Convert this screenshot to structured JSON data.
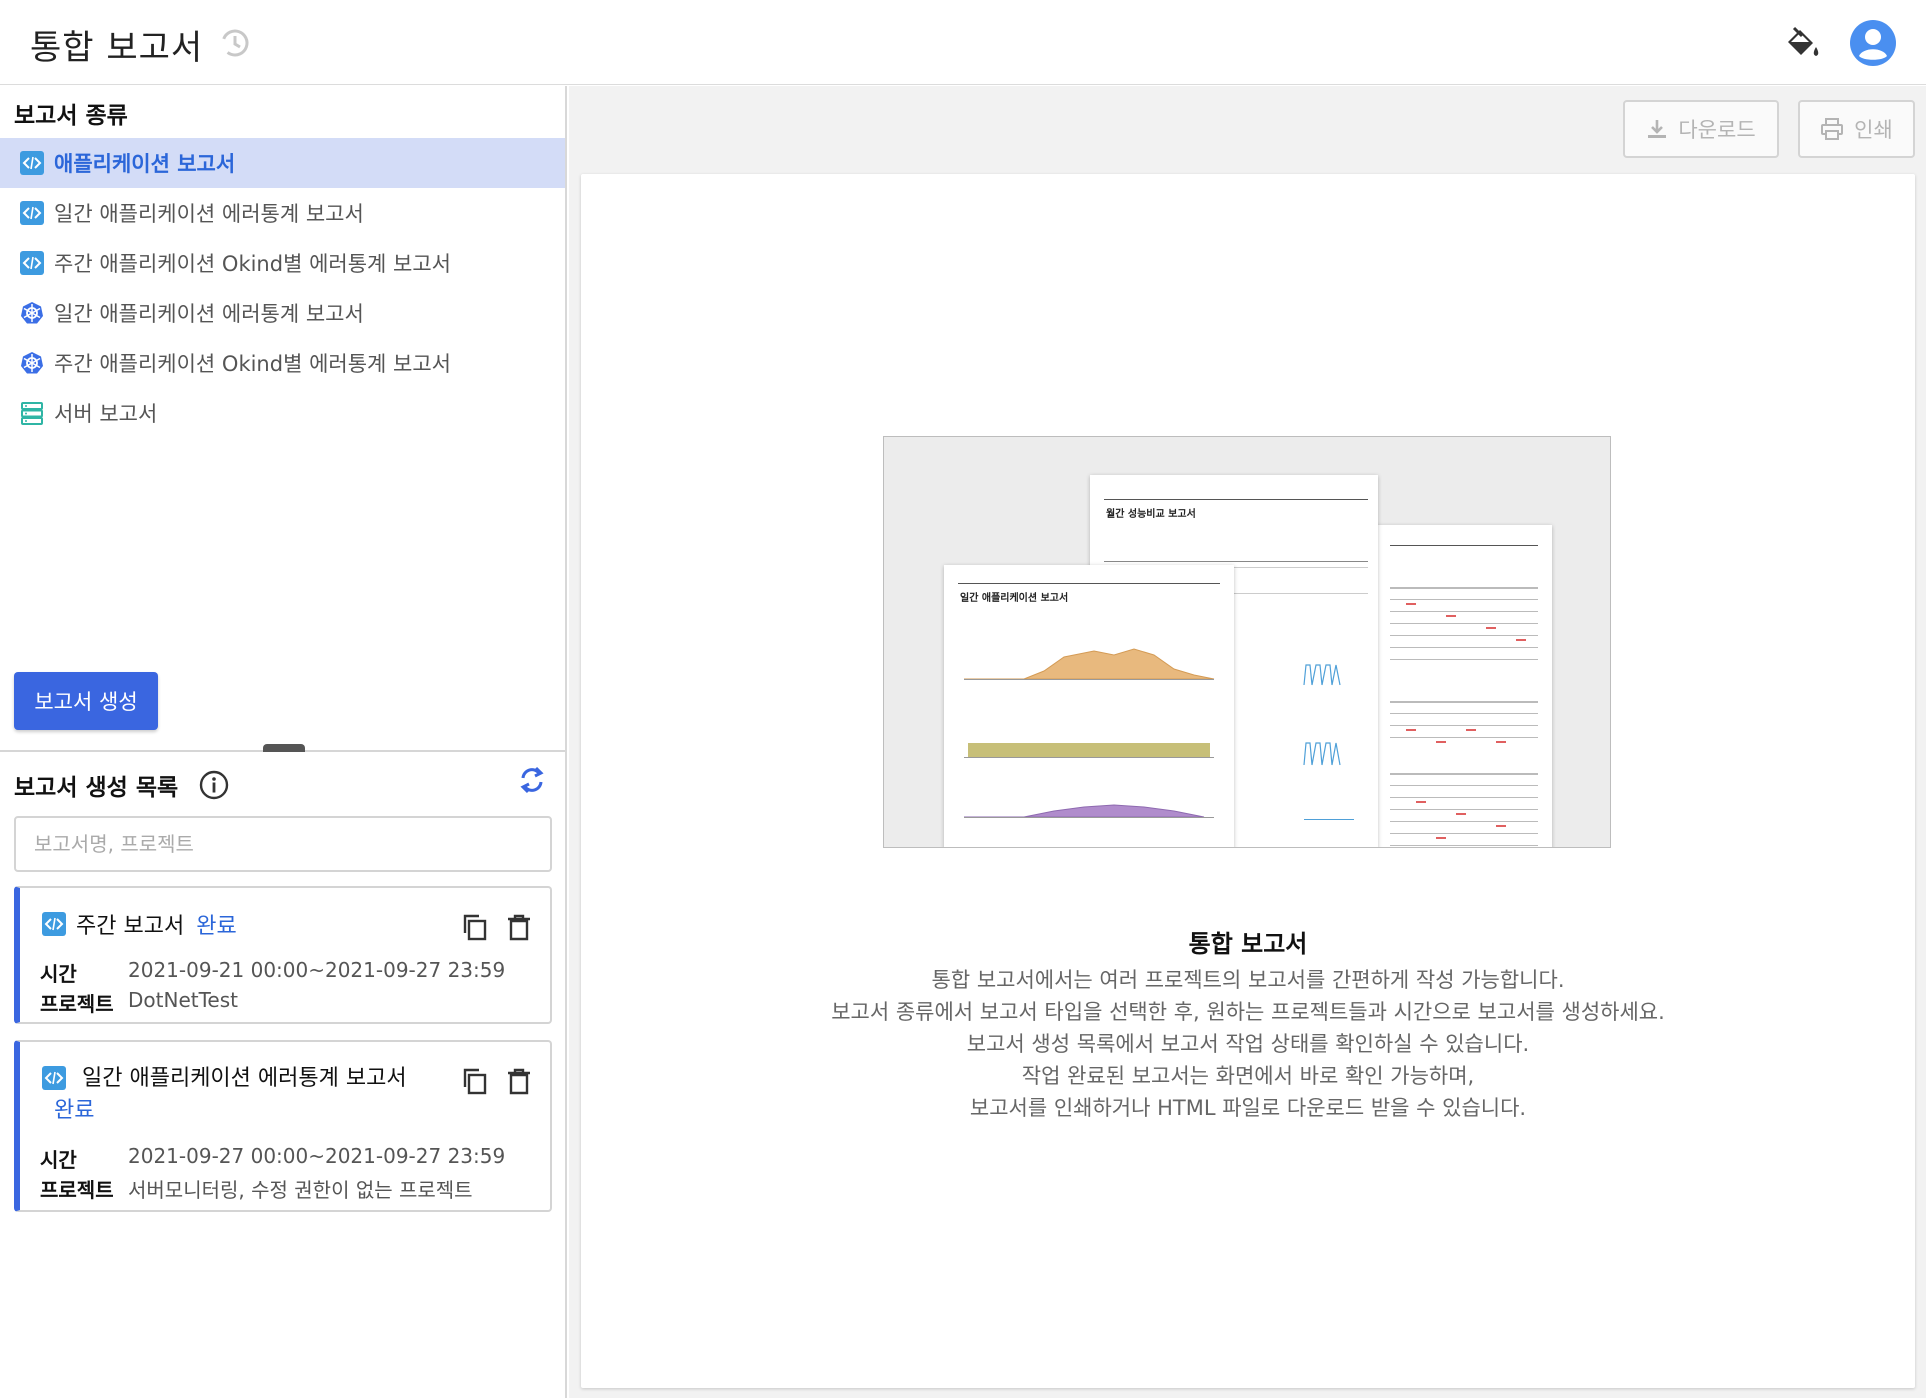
{
  "header": {
    "title": "통합 보고서",
    "history_icon": "history-icon",
    "theme_icon": "paint-bucket-icon",
    "account_icon": "account-circle-icon",
    "accent_color": "#3a66e0"
  },
  "report_types": {
    "title": "보고서 종류",
    "items": [
      {
        "label": "애플리케이션 보고서",
        "icon": "code-icon",
        "active": true
      },
      {
        "label": "일간 애플리케이션 에러통계 보고서",
        "icon": "code-icon",
        "active": false
      },
      {
        "label": "주간 애플리케이션 Okind별 에러통계 보고서",
        "icon": "code-icon",
        "active": false
      },
      {
        "label": "일간 애플리케이션 에러통계 보고서",
        "icon": "kubernetes-icon",
        "active": false
      },
      {
        "label": "주간 애플리케이션 Okind별 에러통계 보고서",
        "icon": "kubernetes-icon",
        "active": false
      },
      {
        "label": "서버 보고서",
        "icon": "server-icon",
        "active": false
      }
    ],
    "create_button": "보고서 생성"
  },
  "report_list": {
    "title": "보고서 생성 목록",
    "search_placeholder": "보고서명, 프로젝트",
    "cards": [
      {
        "title": "주간 보고서",
        "status": "완료",
        "time_label": "시간",
        "time": "2021-09-21 00:00~2021-09-27 23:59",
        "project_label": "프로젝트",
        "project": "DotNetTest"
      },
      {
        "title": "일간 애플리케이션 에러통계 보고서",
        "status": "완료",
        "time_label": "시간",
        "time": "2021-09-27 00:00~2021-09-27 23:59",
        "project_label": "프로젝트",
        "project": "서버모니터링, 수정 권한이 없는 프로젝트"
      }
    ]
  },
  "toolbar": {
    "download_label": "다운로드",
    "print_label": "인쇄"
  },
  "preview": {
    "page_back_title": "월간 성능비교 보고서",
    "page_front_title": "일간 애플리케이션 보고서"
  },
  "intro": {
    "heading": "통합 보고서",
    "lines": [
      "통합 보고서에서는 여러 프로젝트의 보고서를 간편하게 작성 가능합니다.",
      "보고서 종류에서 보고서 타입을 선택한 후, 원하는 프로젝트들과 시간으로 보고서를 생성하세요.",
      "보고서 생성 목록에서 보고서 작업 상태를 확인하실 수 있습니다.",
      "작업 완료된 보고서는 화면에서 바로 확인 가능하며,",
      "보고서를 인쇄하거나 HTML 파일로 다운로드 받을 수 있습니다."
    ]
  }
}
